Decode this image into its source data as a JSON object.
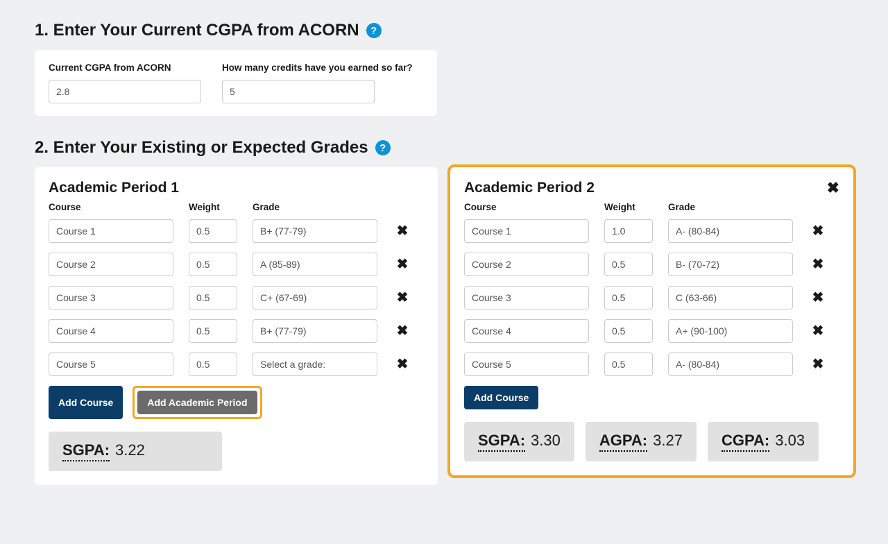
{
  "section1": {
    "title": "1. Enter Your Current CGPA from ACORN",
    "cgpa_label": "Current CGPA from ACORN",
    "cgpa_value": "2.8",
    "credits_label": "How many credits have you earned so far?",
    "credits_value": "5"
  },
  "section2": {
    "title": "2. Enter Your Existing or Expected Grades"
  },
  "headers": {
    "course": "Course",
    "weight": "Weight",
    "grade": "Grade"
  },
  "buttons": {
    "add_course": "Add Course",
    "add_period": "Add Academic Period"
  },
  "period1": {
    "title": "Academic Period 1",
    "rows": [
      {
        "course": "Course 1",
        "weight": "0.5",
        "grade": "B+ (77-79)"
      },
      {
        "course": "Course 2",
        "weight": "0.5",
        "grade": "A (85-89)"
      },
      {
        "course": "Course 3",
        "weight": "0.5",
        "grade": "C+ (67-69)"
      },
      {
        "course": "Course 4",
        "weight": "0.5",
        "grade": "B+ (77-79)"
      },
      {
        "course": "Course 5",
        "weight": "0.5",
        "grade": "Select a grade:"
      }
    ],
    "sgpa_label": "SGPA:",
    "sgpa_value": "3.22"
  },
  "period2": {
    "title": "Academic Period 2",
    "rows": [
      {
        "course": "Course 1",
        "weight": "1.0",
        "grade": "A- (80-84)"
      },
      {
        "course": "Course 2",
        "weight": "0.5",
        "grade": "B- (70-72)"
      },
      {
        "course": "Course 3",
        "weight": "0.5",
        "grade": "C (63-66)"
      },
      {
        "course": "Course 4",
        "weight": "0.5",
        "grade": "A+ (90-100)"
      },
      {
        "course": "Course 5",
        "weight": "0.5",
        "grade": "A- (80-84)"
      }
    ],
    "sgpa_label": "SGPA:",
    "sgpa_value": "3.30",
    "agpa_label": "AGPA:",
    "agpa_value": "3.27",
    "cgpa_label": "CGPA:",
    "cgpa_value": "3.03"
  }
}
